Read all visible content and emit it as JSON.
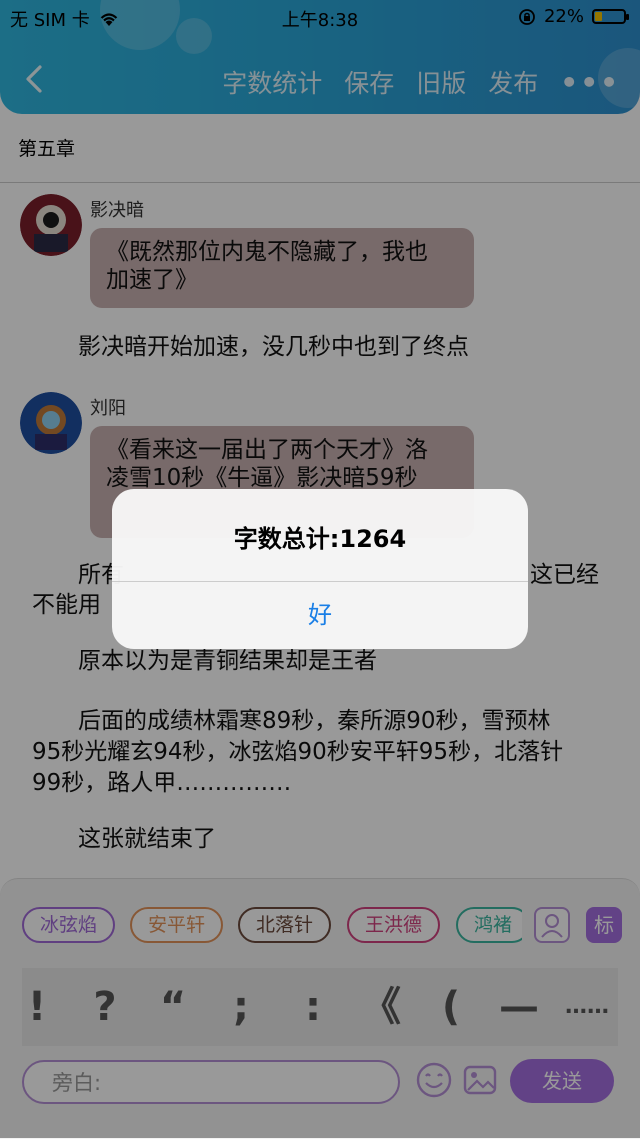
{
  "status_bar": {
    "carrier": "无 SIM 卡",
    "time": "上午8:38",
    "battery_percent": "22%",
    "battery_level": 0.22
  },
  "header": {
    "actions": [
      "字数统计",
      "保存",
      "旧版",
      "发布"
    ],
    "more": "•••",
    "gradient": [
      "#2fb7df",
      "#2d90cf"
    ]
  },
  "chapter_title": "第五章",
  "messages": [
    {
      "type": "dialog",
      "speaker": "影决暗",
      "text_lines": [
        "《既然那位内鬼不隐藏了，我也",
        "加速了》"
      ]
    },
    {
      "type": "narration",
      "text": "影决暗开始加速，没几秒中也到了终点"
    },
    {
      "type": "dialog",
      "speaker": "刘阳",
      "text_lines": [
        "《看来这一届出了两个天才》洛",
        "凌雪10秒《牛逼》影决暗59秒"
      ]
    },
    {
      "type": "narration_partial",
      "text_left": "所有",
      "text_right": "这已经",
      "text_line2": "不能用"
    },
    {
      "type": "narration",
      "text": "原本以为是青铜结果却是王者"
    },
    {
      "type": "narration",
      "text_lines": [
        "后面的成绩林霜寒89秒，秦所源90秒，雪预林",
        "95秒光耀玄94秒，冰弦焰90秒安平轩95秒，北落针",
        "99秒，路人甲……………"
      ]
    },
    {
      "type": "narration",
      "text": "这张就结束了"
    }
  ],
  "character_tags": [
    {
      "label": "冰弦焰",
      "color": "#a06ad8"
    },
    {
      "label": "安平轩",
      "color": "#e3935a"
    },
    {
      "label": "北落针",
      "color": "#6b4a3c"
    },
    {
      "label": "王洪德",
      "color": "#d0417f"
    },
    {
      "label": "鸿褚",
      "color": "#3bb6a0"
    }
  ],
  "tag_buttons": {
    "person_icon": "person-icon",
    "mark_label": "标"
  },
  "punctuation": [
    "!",
    "?",
    "“",
    ";",
    ":",
    "《",
    "(",
    "—",
    "……"
  ],
  "input": {
    "placeholder": "旁白:"
  },
  "send_label": "发送",
  "alert": {
    "title": "字数总计:1264",
    "ok_label": "好"
  }
}
